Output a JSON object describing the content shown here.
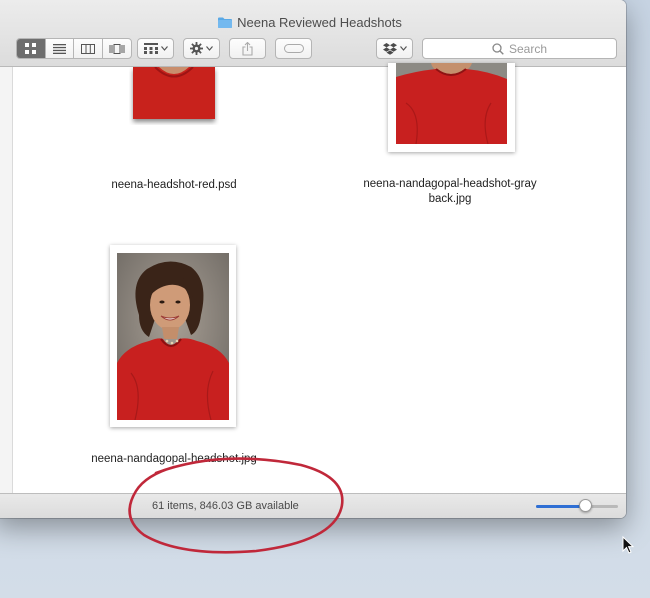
{
  "window": {
    "title": "Neena Reviewed Headshots"
  },
  "toolbar": {
    "view_modes": [
      "icon-view",
      "list-view",
      "column-view",
      "cover-flow-view"
    ],
    "active_view": "icon-view",
    "search_placeholder": "Search"
  },
  "files": [
    {
      "name": "neena-headshot-red.psd"
    },
    {
      "name": "neena-nandagopal-headshot-gray back.jpg",
      "line1": "neena-nandagopal-headshot-gray",
      "line2": "back.jpg"
    },
    {
      "name": "neena-nandagopal-headshot.jpg"
    }
  ],
  "status": {
    "text": "61 items, 846.03 GB available",
    "icon_size_level": 0.6
  },
  "colors": {
    "annotation_circle": "#c0283a",
    "slider_accent": "#2f6fd4",
    "shirt_red": "#c8201f"
  }
}
